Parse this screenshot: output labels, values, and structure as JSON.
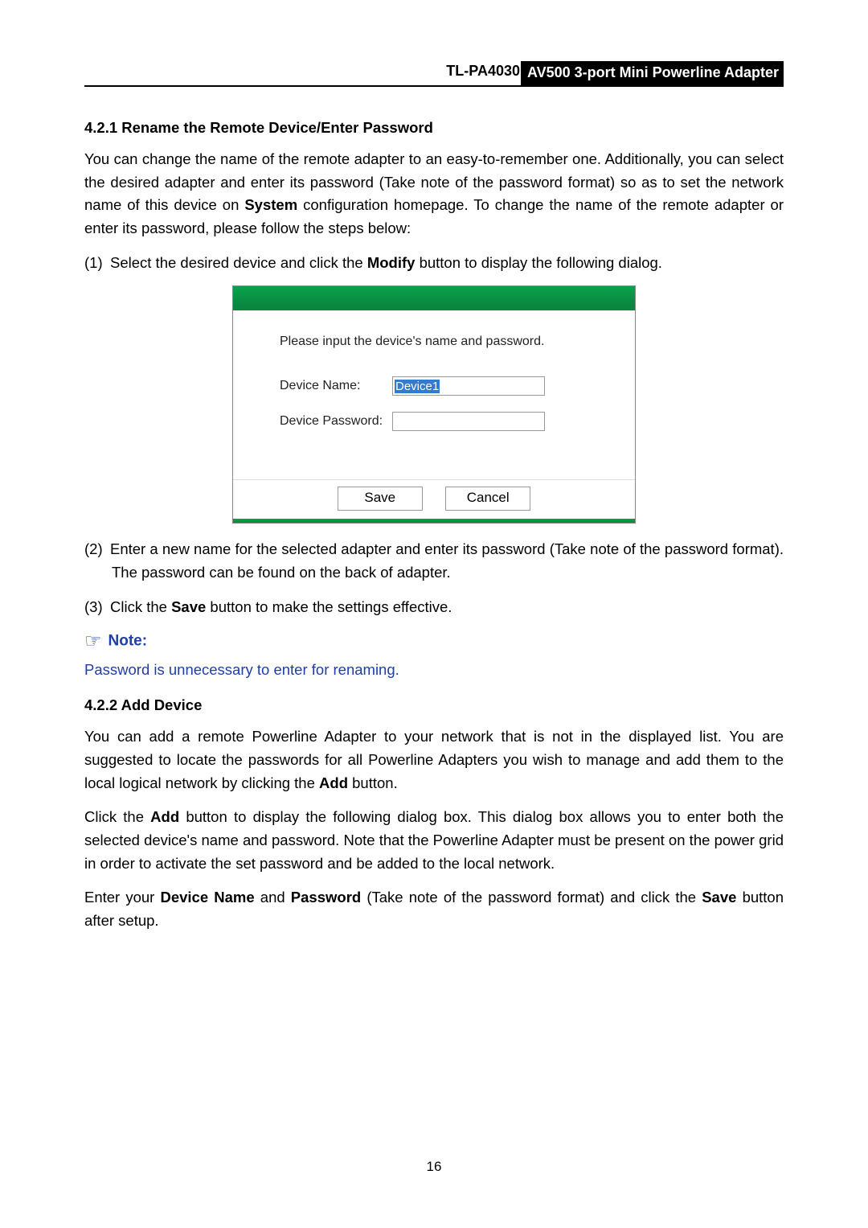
{
  "header": {
    "model": "TL-PA4030",
    "product": "AV500 3-port Mini Powerline Adapter"
  },
  "section421": {
    "heading": "4.2.1 Rename the Remote Device/Enter Password",
    "p1_a": "You can change the name of the remote adapter to an easy-to-remember one. Additionally, you can select the desired adapter and enter its password (Take note of the password format) so as to set the network name of this device on ",
    "p1_bold": "System",
    "p1_b": " configuration homepage. To change the name of the remote adapter or enter its password, please follow the steps below:",
    "step1_num": "(1)",
    "step1_a": "Select the desired device and click the ",
    "step1_bold": "Modify",
    "step1_b": " button to display the following dialog.",
    "step2_num": "(2)",
    "step2": "Enter a new name for the selected adapter and enter its password (Take note of the password format). The password can be found on the back of adapter.",
    "step3_num": "(3)",
    "step3_a": "Click the ",
    "step3_bold": "Save",
    "step3_b": " button to make the settings effective."
  },
  "dialog": {
    "instruction": "Please input the device's name and password.",
    "name_label": "Device Name:",
    "name_value": "Device1",
    "password_label": "Device Password:",
    "password_value": "",
    "save": "Save",
    "cancel": "Cancel"
  },
  "note": {
    "label": "Note:",
    "body": "Password is unnecessary to enter for renaming."
  },
  "section422": {
    "heading": "4.2.2 Add Device",
    "p1_a": "You can add a remote Powerline Adapter to your network that is not in the displayed list. You are suggested to locate the passwords for all Powerline Adapters you wish to manage and add them to the local logical network by clicking the ",
    "p1_bold": "Add",
    "p1_b": " button.",
    "p2_a": "Click the ",
    "p2_bold": "Add",
    "p2_b": " button to display the following dialog box. This dialog box allows you to enter both the selected device's name and password. Note that the Powerline Adapter must be present on the power grid in order to activate the set password and be added to the local network.",
    "p3_a": "Enter your ",
    "p3_bold1": "Device Name",
    "p3_mid": " and ",
    "p3_bold2": "Password",
    "p3_b": " (Take note of the password format) and click the ",
    "p3_bold3": "Save",
    "p3_c": " button after setup."
  },
  "page_number": "16"
}
